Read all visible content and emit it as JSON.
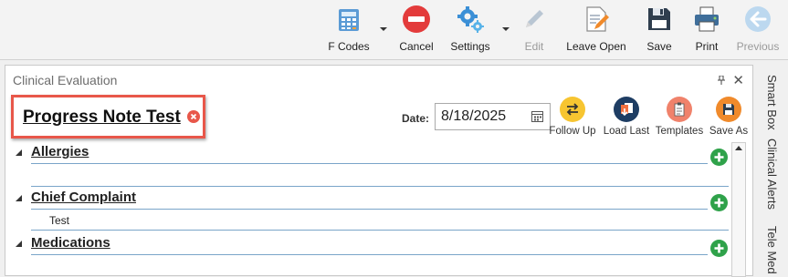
{
  "toolbar": {
    "fcodes": "F Codes",
    "cancel": "Cancel",
    "settings": "Settings",
    "edit": "Edit",
    "leave_open": "Leave Open",
    "save": "Save",
    "print": "Print",
    "previous": "Previous"
  },
  "panel": {
    "title": "Clinical Evaluation",
    "note_title": "Progress Note Test",
    "date_label": "Date:",
    "date_value": "8/18/2025",
    "actions": {
      "follow_up": "Follow Up",
      "load_last": "Load Last",
      "templates": "Templates",
      "save_as": "Save As"
    },
    "sections": [
      {
        "title": "Allergies",
        "body": ""
      },
      {
        "title": "Chief Complaint",
        "body": "Test"
      },
      {
        "title": "Medications",
        "body": ""
      }
    ]
  },
  "side_tabs": [
    "Smart Box",
    "Clinical Alerts",
    "Tele Med"
  ],
  "colors": {
    "accent_red": "#e8574a",
    "add_green": "#2fa24a",
    "line_blue": "#7aa5c9"
  }
}
